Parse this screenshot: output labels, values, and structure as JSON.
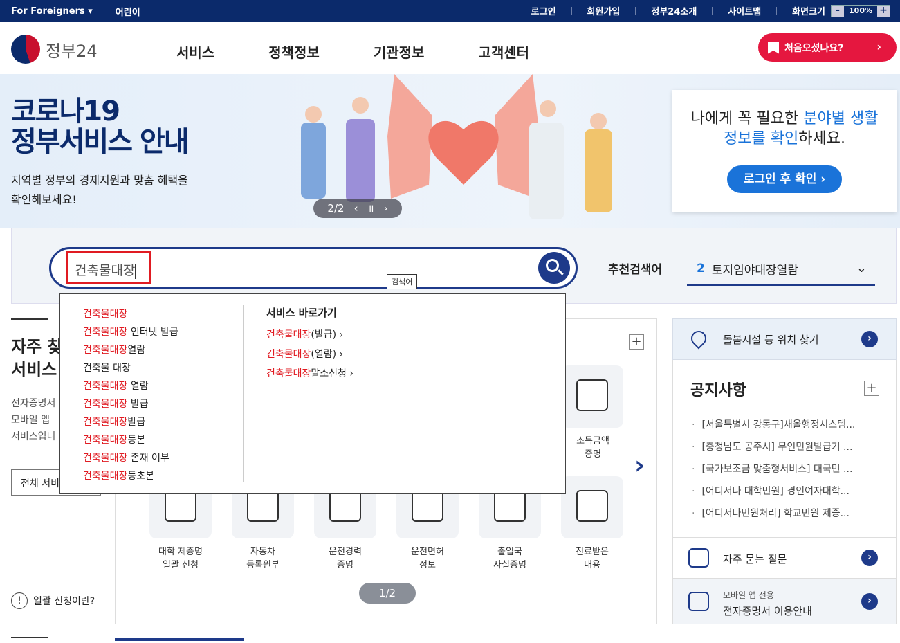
{
  "topbar": {
    "lang": "For Foreigners ▾",
    "kids": "어린이",
    "login": "로그인",
    "join": "회원가입",
    "intro": "정부24소개",
    "sitemap": "사이트맵",
    "screensize": "화면크기",
    "zoom_minus": "-",
    "zoom_value": "100%",
    "zoom_plus": "+"
  },
  "header": {
    "logo_text": "정부24",
    "nav": [
      "서비스",
      "정책정보",
      "기관정보",
      "고객센터"
    ],
    "first_visit": "처음오셨나요?"
  },
  "banner": {
    "title_line1": "코로나19",
    "title_line2": "정부서비스 안내",
    "sub_line1": "지역별 정부의 경제지원과 맞춤 혜택을",
    "sub_line2": "확인해보세요!",
    "pager": "2/2",
    "login_msg_1": "나에게 꼭 필요한 ",
    "login_msg_hl1": "분야별 생활",
    "login_msg_hl2": "정보를 확인",
    "login_msg_2": "하세요.",
    "login_btn": "로그인 후 확인 ›"
  },
  "search": {
    "value": "건축물대장",
    "tooltip": "검색어",
    "rec_label": "추천검색어",
    "rec_num": "2",
    "rec_text": "토지임야대장열람"
  },
  "autocomplete": {
    "items": [
      {
        "hl": "건축물대장",
        "rest": ""
      },
      {
        "hl": "건축물대장",
        "rest": " 인터넷 발급"
      },
      {
        "hl": "건축물대장",
        "rest": "열람"
      },
      {
        "hl": "",
        "rest": "건축물 대장"
      },
      {
        "hl": "건축물대장",
        "rest": " 열람"
      },
      {
        "hl": "건축물대장",
        "rest": " 발급"
      },
      {
        "hl": "건축물대장",
        "rest": "발급"
      },
      {
        "hl": "건축물대장",
        "rest": "등본"
      },
      {
        "hl": "건축물대장",
        "rest": " 존재 여부"
      },
      {
        "hl": "건축물대장",
        "rest": "등초본"
      }
    ],
    "svc_title": "서비스 바로가기",
    "svc": [
      {
        "hl": "건축물대장",
        "rest": "(발급)  ›"
      },
      {
        "hl": "건축물대장",
        "rest": "(열람)  ›"
      },
      {
        "hl": "건축물대장",
        "rest": "말소신청  ›"
      }
    ]
  },
  "left": {
    "title1": "자주 찾",
    "title2": "서비스",
    "desc1": "전자증명서",
    "desc2": "모바일 앱",
    "desc3": "서비스입니",
    "all_btn": "전체 서비",
    "ilgual_icon": "!",
    "ilgual": "일괄 신청이란?"
  },
  "services": {
    "row1_label": [
      "소득금액",
      "증명"
    ],
    "items": [
      {
        "l1": "대학 제증명",
        "l2": "일괄 신청"
      },
      {
        "l1": "자동차",
        "l2": "등록원부"
      },
      {
        "l1": "운전경력",
        "l2": "증명"
      },
      {
        "l1": "운전면허",
        "l2": "정보"
      },
      {
        "l1": "출입국",
        "l2": "사실증명"
      },
      {
        "l1": "진료받은",
        "l2": "내용"
      }
    ],
    "pager": "1/2"
  },
  "right": {
    "care": "돌봄시설 등 위치 찾기",
    "notice_title": "공지사항",
    "notices": [
      "[서울특별시 강동구]새올행정시스템...",
      "[충청남도 공주시] 무인민원발급기 ...",
      "[국가보조금 맞춤형서비스] 대국민 ...",
      "[어디서나 대학민원] 경인여자대학...",
      "[어디서나민원처리] 학교민원 제증..."
    ],
    "faq": "자주 묻는 질문",
    "mob_a": "모바일 앱 전용",
    "mob_b": "전자증명서 이용안내"
  }
}
